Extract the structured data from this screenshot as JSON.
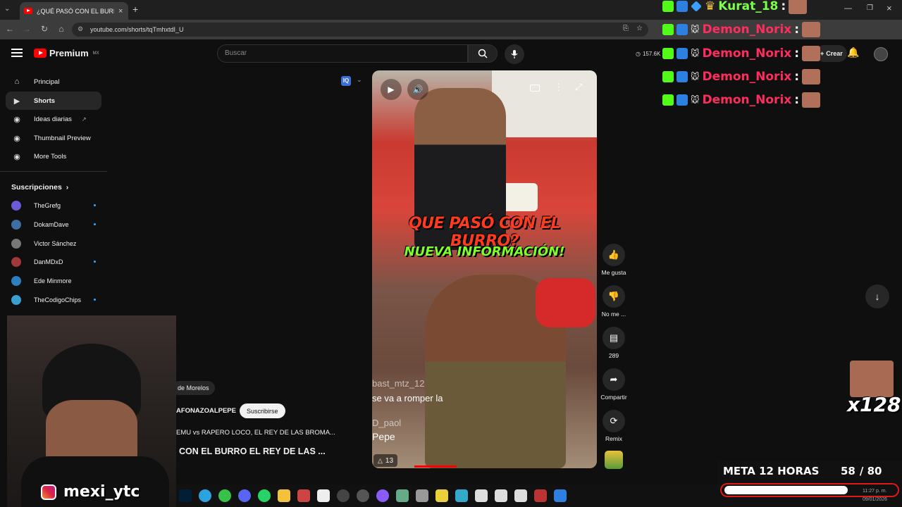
{
  "browser": {
    "tab_title": "¿QUÉ PASÓ CON EL BURRO EL",
    "url": "youtube.com/shorts/tqTmhxtdI_U"
  },
  "header": {
    "logo_text": "Premium",
    "logo_region": "MX",
    "search_placeholder": "Buscar",
    "stats_count": "157.6K",
    "create_label": "Crear"
  },
  "sidebar": {
    "items": [
      {
        "label": "Principal",
        "icon": "home-icon"
      },
      {
        "label": "Shorts",
        "icon": "shorts-icon"
      },
      {
        "label": "Ideas diarias",
        "icon": "bulb-icon"
      },
      {
        "label": "Thumbnail Preview",
        "icon": "image-icon"
      },
      {
        "label": "More Tools",
        "icon": "tools-icon"
      }
    ],
    "subs_title": "Suscripciones",
    "subscriptions": [
      {
        "name": "TheGrefg",
        "color": "#6b5bd6",
        "dot": true
      },
      {
        "name": "DokamDave",
        "color": "#3d6fa3",
        "dot": true
      },
      {
        "name": "Victor Sánchez",
        "color": "#777777",
        "dot": false
      },
      {
        "name": "DanMDxD",
        "color": "#a03a3a",
        "dot": true
      },
      {
        "name": "Ede Minmore",
        "color": "#2d80c0",
        "dot": false
      },
      {
        "name": "TheCodigoChips",
        "color": "#3aa0d0",
        "dot": true
      }
    ]
  },
  "short": {
    "overlay_line1": "QUE PASÓ CON EL BURRO?",
    "overlay_line2": "NUEVA INFORMACIÓN!",
    "captions": [
      "bast_mtz_12",
      "se va a romper la",
      "D_paol",
      "Pepe"
    ],
    "likes_badge": "13",
    "location_chip": "de Morelos",
    "channel_name": "AFONAZOALPEPE",
    "subscribe_label": "Suscribirse",
    "related_title": "EMU vs RAPERO LOCO, EL REY DE LAS BROMA...",
    "video_title": "CON EL BURRO EL REY DE LAS ..."
  },
  "actions": [
    {
      "label": "Me gusta",
      "icon": "thumbs-up-icon"
    },
    {
      "label": "No me ...",
      "icon": "thumbs-down-icon"
    },
    {
      "label": "289",
      "icon": "comment-icon"
    },
    {
      "label": "Compartir",
      "icon": "share-icon"
    },
    {
      "label": "Remix",
      "icon": "remix-icon"
    }
  ],
  "stream_overlay": {
    "chat": [
      {
        "user": "Kurat_18",
        "color": "#7cff4a"
      },
      {
        "user": "Demon_Norix",
        "color": "#ff2d5e"
      },
      {
        "user": "Demon_Norix",
        "color": "#ff2d5e"
      },
      {
        "user": "Demon_Norix",
        "color": "#ff2d5e"
      },
      {
        "user": "Demon_Norix",
        "color": "#ff2d5e"
      }
    ],
    "multiplier": "x128",
    "goal_label": "META 12 HORAS",
    "goal_current": "58",
    "goal_total": "/ 80",
    "goal_progress": 0.725,
    "streamer_handle": "mexi_ytc",
    "clock": "11:27 p. m.",
    "date": "09/01/2026"
  }
}
